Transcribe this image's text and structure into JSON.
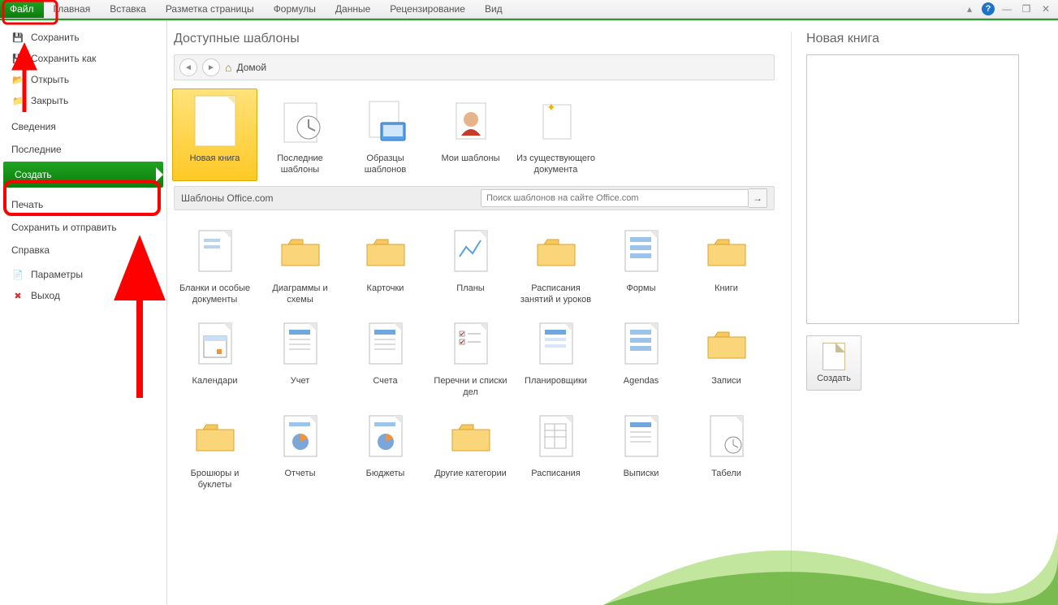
{
  "ribbon": {
    "tabs": [
      "Файл",
      "Главная",
      "Вставка",
      "Разметка страницы",
      "Формулы",
      "Данные",
      "Рецензирование",
      "Вид"
    ]
  },
  "sidebar": {
    "items": [
      {
        "label": "Сохранить",
        "icon": "save"
      },
      {
        "label": "Сохранить как",
        "icon": "saveas"
      },
      {
        "label": "Открыть",
        "icon": "open"
      },
      {
        "label": "Закрыть",
        "icon": "close"
      }
    ],
    "sections": [
      "Сведения",
      "Последние",
      "Создать",
      "Печать",
      "Сохранить и отправить",
      "Справка"
    ],
    "footer": [
      {
        "label": "Параметры",
        "icon": "options"
      },
      {
        "label": "Выход",
        "icon": "exit"
      }
    ],
    "active": "Создать"
  },
  "main": {
    "title": "Доступные шаблоны",
    "breadcrumb": "Домой",
    "top_templates": [
      "Новая книга",
      "Последние шаблоны",
      "Образцы шаблонов",
      "Мои шаблоны",
      "Из существую­щего документа"
    ],
    "office_section": "Шаблоны Office.com",
    "search_placeholder": "Поиск шаблонов на сайте Office.com",
    "categories_row1": [
      "Бланки и особые документы",
      "Диаграммы и схемы",
      "Карточки",
      "Планы",
      "Расписания занятий и уроков",
      "Формы",
      "Книги"
    ],
    "categories_row2": [
      "Календари",
      "Учет",
      "Счета",
      "Перечни и списки дел",
      "Планировщики",
      "Agendas",
      "Записи"
    ],
    "categories_row3": [
      "Брошюры и буклеты",
      "Отчеты",
      "Бюджеты",
      "Другие категории",
      "Расписания",
      "Выписки",
      "Табели"
    ]
  },
  "right": {
    "title": "Новая книга",
    "create": "Создать"
  }
}
